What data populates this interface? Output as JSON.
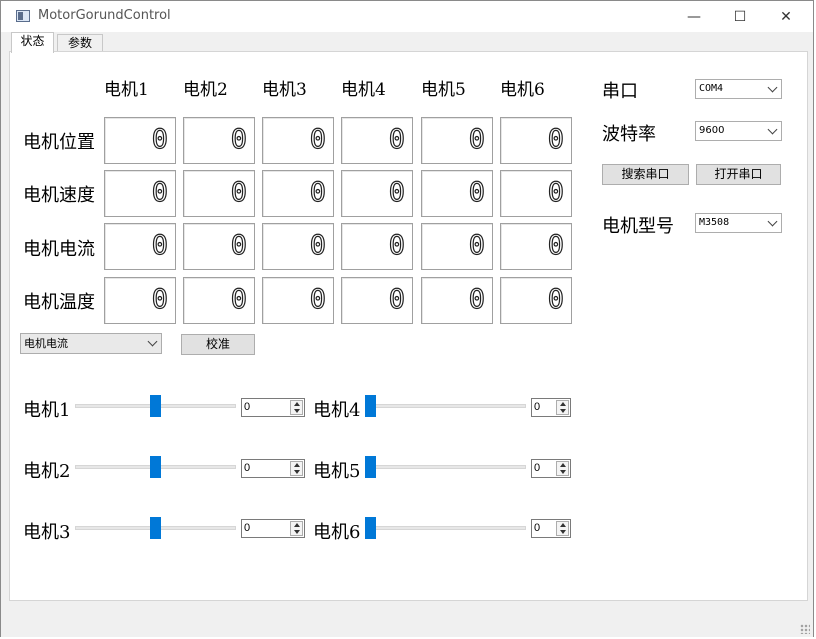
{
  "window": {
    "title": "MotorGorundControl",
    "minimize": "—",
    "maximize": "☐",
    "close": "✕"
  },
  "tabs": [
    {
      "label": "状态"
    },
    {
      "label": "参数"
    }
  ],
  "grid": {
    "columns": [
      "电机1",
      "电机2",
      "电机3",
      "电机4",
      "电机5",
      "电机6"
    ],
    "rows": [
      "电机位置",
      "电机速度",
      "电机电流",
      "电机温度"
    ],
    "values": [
      [
        "0",
        "0",
        "0",
        "0",
        "0",
        "0"
      ],
      [
        "0",
        "0",
        "0",
        "0",
        "0",
        "0"
      ],
      [
        "0",
        "0",
        "0",
        "0",
        "0",
        "0"
      ],
      [
        "0",
        "0",
        "0",
        "0",
        "0",
        "0"
      ]
    ]
  },
  "display_select": {
    "value": "电机电流"
  },
  "calibrate_button": "校准",
  "sliders": [
    {
      "label": "电机1",
      "spin": "0",
      "level": 0.5
    },
    {
      "label": "电机2",
      "spin": "0",
      "level": 0.5
    },
    {
      "label": "电机3",
      "spin": "0",
      "level": 0.5
    },
    {
      "label": "电机4",
      "spin": "0",
      "level": 0
    },
    {
      "label": "电机5",
      "spin": "0",
      "level": 0
    },
    {
      "label": "电机6",
      "spin": "0",
      "level": 0
    }
  ],
  "serial": {
    "port_label": "串口",
    "port_value": "COM4",
    "baud_label": "波特率",
    "baud_value": "9600",
    "search_button": "搜索串口",
    "open_button": "打开串口",
    "motor_type_label": "电机型号",
    "motor_type_value": "M3508"
  },
  "accent_color": "#0078d7"
}
